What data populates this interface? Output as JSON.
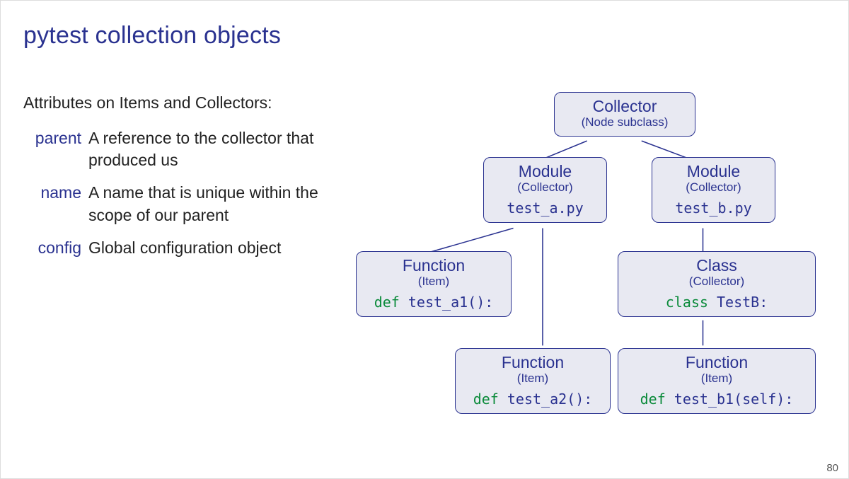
{
  "title": "pytest collection objects",
  "page_number": "80",
  "attrs": {
    "heading": "Attributes on Items and Collectors:",
    "items": [
      {
        "term": "parent",
        "desc": "A reference to the collector that produced us"
      },
      {
        "term": "name",
        "desc": "A name that is unique within the scope of our parent"
      },
      {
        "term": "config",
        "desc": "Global configuration object"
      }
    ]
  },
  "tree": {
    "collector": {
      "title": "Collector",
      "sub": "(Node subclass)"
    },
    "module_a": {
      "title": "Module",
      "sub": "(Collector)",
      "code_kw": "",
      "code_rest": "test_a.py"
    },
    "module_b": {
      "title": "Module",
      "sub": "(Collector)",
      "code_kw": "",
      "code_rest": "test_b.py"
    },
    "func_a1": {
      "title": "Function",
      "sub": "(Item)",
      "code_kw": "def ",
      "code_rest": "test_a1():"
    },
    "func_a2": {
      "title": "Function",
      "sub": "(Item)",
      "code_kw": "def ",
      "code_rest": "test_a2():"
    },
    "class_b": {
      "title": "Class",
      "sub": "(Collector)",
      "code_kw": "class ",
      "code_rest": "TestB:"
    },
    "func_b1": {
      "title": "Function",
      "sub": "(Item)",
      "code_kw": "def ",
      "code_rest": "test_b1(self):"
    }
  },
  "chart_data": {
    "type": "tree",
    "title": "pytest collection objects",
    "nodes": [
      {
        "id": "collector",
        "label": "Collector",
        "subtype": "Node subclass"
      },
      {
        "id": "module_a",
        "label": "Module",
        "subtype": "Collector",
        "code": "test_a.py"
      },
      {
        "id": "module_b",
        "label": "Module",
        "subtype": "Collector",
        "code": "test_b.py"
      },
      {
        "id": "func_a1",
        "label": "Function",
        "subtype": "Item",
        "code": "def test_a1():"
      },
      {
        "id": "func_a2",
        "label": "Function",
        "subtype": "Item",
        "code": "def test_a2():"
      },
      {
        "id": "class_b",
        "label": "Class",
        "subtype": "Collector",
        "code": "class TestB:"
      },
      {
        "id": "func_b1",
        "label": "Function",
        "subtype": "Item",
        "code": "def test_b1(self):"
      }
    ],
    "edges": [
      [
        "collector",
        "module_a"
      ],
      [
        "collector",
        "module_b"
      ],
      [
        "module_a",
        "func_a1"
      ],
      [
        "module_a",
        "func_a2"
      ],
      [
        "module_b",
        "class_b"
      ],
      [
        "class_b",
        "func_b1"
      ]
    ]
  }
}
